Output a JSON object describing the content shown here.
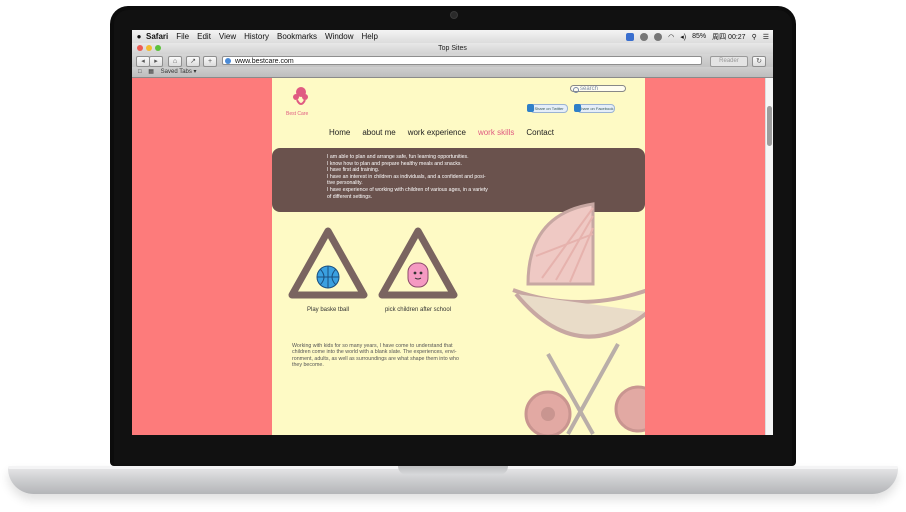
{
  "menubar": {
    "apple_glyph": "",
    "items": [
      "Safari",
      "File",
      "Edit",
      "View",
      "History",
      "Bookmarks",
      "Window",
      "Help"
    ],
    "tray": {
      "battery": "85%",
      "clock": "周四 00:27"
    }
  },
  "window": {
    "title": "Top Sites"
  },
  "toolbar": {
    "url": "www.bestcare.com",
    "reader_label": "Reader"
  },
  "bookmarks": {
    "saved_tabs": "Saved Tabs ▾"
  },
  "site": {
    "logo_text": "Best Care",
    "search_placeholder": "search",
    "share_buttons": [
      "Share on Twitter",
      "Share on Facebook"
    ],
    "nav": [
      "Home",
      "about me",
      "work experience",
      "work skills",
      "Contact"
    ],
    "active_nav": "work skills",
    "skills": [
      "I am able to plan and arrange safe, fun learning opportunities.",
      "I know how to plan and prepare healthy meals and snacks.",
      "I have first aid training.",
      "I have an interest in children as individuals, and a confident and posi-",
      "tive personality.",
      "I have experience of working with children of various ages, in a variety",
      "of different settings."
    ],
    "items": [
      {
        "caption": "Play baske tball",
        "icon": "basketball-icon"
      },
      {
        "caption": "pick children after school",
        "icon": "backpack-icon"
      }
    ],
    "paragraph": [
      "Working with kids for so many years, I have come to understand that",
      "children come into the world with a blank slate. The experiences, envi-",
      "ronment, adults, as well as surroundings are what shape them into who",
      "they become."
    ]
  },
  "colors": {
    "background_pink": "#fd7b7b",
    "page_cream": "#fefac5",
    "infobox_brown": "#6a524d",
    "accent_pink": "#e05b82",
    "triangle_brown": "#7a6460"
  }
}
